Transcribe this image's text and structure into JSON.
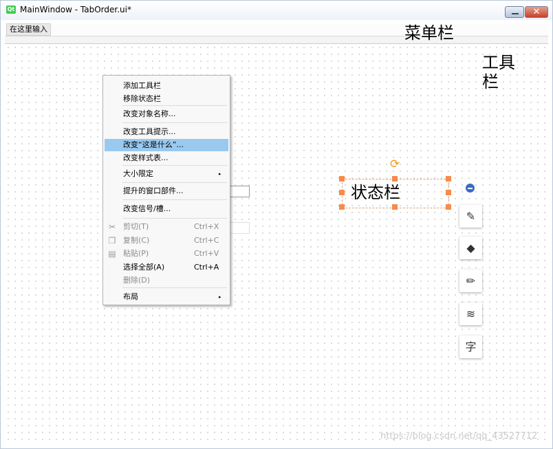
{
  "window": {
    "logo": "Qt",
    "title": "MainWindow - TabOrder.ui*",
    "minimize_icon": "minimize-icon",
    "close_glyph": "✕"
  },
  "menubar": {
    "entry_label": "在这里输入"
  },
  "annotations": {
    "menubar_note": "菜单栏",
    "toolbar_note": "工具栏",
    "statusbar_label": "状态栏"
  },
  "context_menu": {
    "items": [
      {
        "label": "添加工具栏",
        "enabled": true
      },
      {
        "label": "移除状态栏",
        "enabled": true
      },
      {
        "label": "改变对象名称...",
        "enabled": true
      },
      {
        "label": "改变工具提示...",
        "enabled": true
      },
      {
        "label": "改变“这是什么”...",
        "enabled": true,
        "highlighted": true
      },
      {
        "label": "改变样式表...",
        "enabled": true
      },
      {
        "label": "大小限定",
        "enabled": true,
        "submenu": true
      },
      {
        "label": "提升的窗口部件...",
        "enabled": true
      },
      {
        "label": "改变信号/槽...",
        "enabled": true
      },
      {
        "label": "剪切(T)",
        "shortcut": "Ctrl+X",
        "enabled": false,
        "icon": "scissors-icon"
      },
      {
        "label": "复制(C)",
        "shortcut": "Ctrl+C",
        "enabled": false,
        "icon": "copy-icon"
      },
      {
        "label": "粘贴(P)",
        "shortcut": "Ctrl+V",
        "enabled": false,
        "icon": "paste-icon"
      },
      {
        "label": "选择全部(A)",
        "shortcut": "Ctrl+A",
        "enabled": true
      },
      {
        "label": "删除(D)",
        "enabled": false
      },
      {
        "label": "布局",
        "enabled": true,
        "submenu": true
      }
    ],
    "submenu_arrow": "▸"
  },
  "tools": [
    {
      "icon": "edit-box-icon",
      "glyph": "✎"
    },
    {
      "icon": "paint-bucket-icon",
      "glyph": "◆"
    },
    {
      "icon": "pen-underline-icon",
      "glyph": "✏"
    },
    {
      "icon": "layers-icon",
      "glyph": "≋"
    },
    {
      "icon": "character-icon",
      "glyph": "字"
    }
  ],
  "colors": {
    "highlight": "#99c9ef",
    "handle": "#f58c4a",
    "accent_blue": "#3a6bc8"
  },
  "watermark": "https://blog.csdn.net/qq_43527712"
}
